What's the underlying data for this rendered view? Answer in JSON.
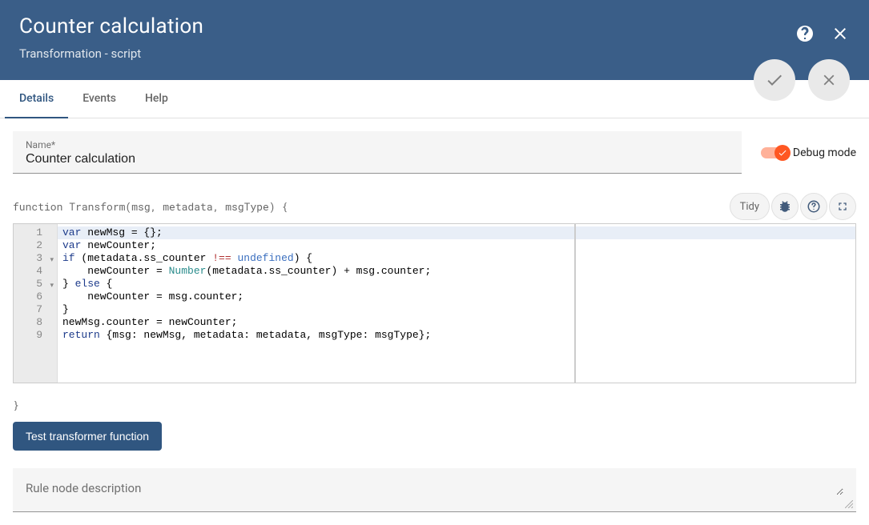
{
  "header": {
    "title": "Counter calculation",
    "subtitle": "Transformation - script"
  },
  "tabs": [
    {
      "label": "Details",
      "active": true
    },
    {
      "label": "Events",
      "active": false
    },
    {
      "label": "Help",
      "active": false
    }
  ],
  "nameField": {
    "label": "Name*",
    "value": "Counter calculation"
  },
  "debug": {
    "label": "Debug mode",
    "enabled": true
  },
  "funcSignature": "function Transform(msg, metadata, msgType) {",
  "closingBrace": "}",
  "editorActions": {
    "tidy": "Tidy"
  },
  "code": {
    "lines": [
      {
        "n": 1,
        "fold": false,
        "hl": true,
        "tokens": [
          [
            "kw",
            "var"
          ],
          [
            "",
            " newMsg = {};"
          ]
        ]
      },
      {
        "n": 2,
        "fold": false,
        "tokens": [
          [
            "kw",
            "var"
          ],
          [
            "",
            " newCounter;"
          ]
        ]
      },
      {
        "n": 3,
        "fold": true,
        "tokens": [
          [
            "kw",
            "if"
          ],
          [
            "",
            " (metadata.ss_counter "
          ],
          [
            "op",
            "!=="
          ],
          [
            "",
            " "
          ],
          [
            "literal",
            "undefined"
          ],
          [
            "",
            ") {"
          ]
        ]
      },
      {
        "n": 4,
        "fold": false,
        "tokens": [
          [
            "",
            "    newCounter = "
          ],
          [
            "builtin",
            "Number"
          ],
          [
            "",
            "(metadata.ss_counter) + msg.counter;"
          ]
        ]
      },
      {
        "n": 5,
        "fold": true,
        "tokens": [
          [
            "",
            "} "
          ],
          [
            "kw",
            "else"
          ],
          [
            "",
            " {"
          ]
        ]
      },
      {
        "n": 6,
        "fold": false,
        "tokens": [
          [
            "",
            "    newCounter = msg.counter;"
          ]
        ]
      },
      {
        "n": 7,
        "fold": false,
        "tokens": [
          [
            "",
            "}"
          ]
        ]
      },
      {
        "n": 8,
        "fold": false,
        "tokens": [
          [
            "",
            "newMsg.counter = newCounter;"
          ]
        ]
      },
      {
        "n": 9,
        "fold": false,
        "tokens": [
          [
            "kw",
            "return"
          ],
          [
            "",
            " {msg: newMsg, metadata: metadata, msgType: msgType};"
          ]
        ]
      }
    ]
  },
  "testButton": "Test transformer function",
  "description": {
    "placeholder": "Rule node description",
    "value": ""
  }
}
